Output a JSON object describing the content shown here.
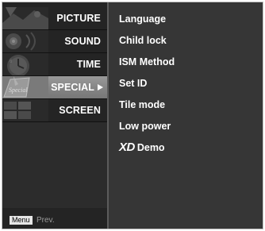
{
  "menu": {
    "items": [
      {
        "label": "PICTURE",
        "icon": "picture-icon"
      },
      {
        "label": "SOUND",
        "icon": "sound-icon"
      },
      {
        "label": "TIME",
        "icon": "clock-icon"
      },
      {
        "label": "SPECIAL",
        "icon": "special-icon",
        "active": true
      },
      {
        "label": "SCREEN",
        "icon": "screen-icon"
      }
    ],
    "special_icon_text": "Special"
  },
  "footer": {
    "menu_button": "Menu",
    "prev_label": "Prev."
  },
  "options": {
    "items": [
      "Language",
      "Child lock",
      "ISM Method",
      "Set ID",
      "Tile mode",
      "Low power"
    ],
    "demo": {
      "logo": "XD",
      "label": "Demo"
    }
  },
  "colors": {
    "menu_background": "#242424",
    "options_background": "#363636",
    "active_highlight": "#8a8a8a",
    "text": "#ffffff",
    "muted_text": "#9a9a9a"
  }
}
